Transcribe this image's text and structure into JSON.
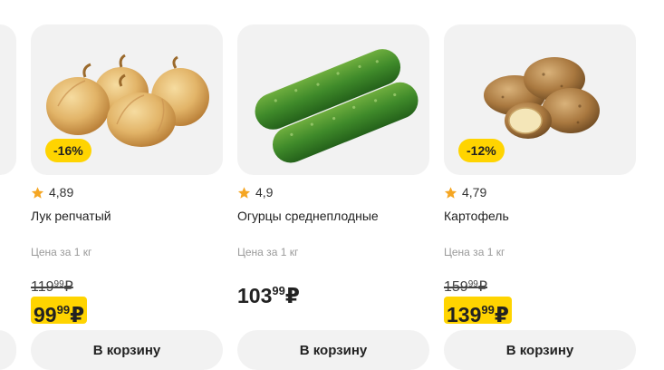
{
  "colors": {
    "card_bg": "#f2f2f2",
    "accent_yellow": "#ffd400",
    "star": "#f5a623"
  },
  "products": [
    {
      "name": "Лук репчатый",
      "rating": "4,89",
      "discount": "-16%",
      "unit_label": "Цена за 1 кг",
      "old_price": {
        "main": "119",
        "cents": "99",
        "currency": "₽"
      },
      "price": {
        "main": "99",
        "cents": "99",
        "currency": "₽"
      },
      "button": "В корзину",
      "image_icon": "onion-image"
    },
    {
      "name": "Огурцы среднеплодные",
      "rating": "4,9",
      "unit_label": "Цена за 1 кг",
      "price": {
        "main": "103",
        "cents": "99",
        "currency": "₽"
      },
      "button": "В корзину",
      "image_icon": "cucumber-image"
    },
    {
      "name": "Картофель",
      "rating": "4,79",
      "discount": "-12%",
      "unit_label": "Цена за 1 кг",
      "old_price": {
        "main": "159",
        "cents": "99",
        "currency": "₽"
      },
      "price": {
        "main": "139",
        "cents": "99",
        "currency": "₽"
      },
      "button": "В корзину",
      "image_icon": "potato-image"
    }
  ]
}
